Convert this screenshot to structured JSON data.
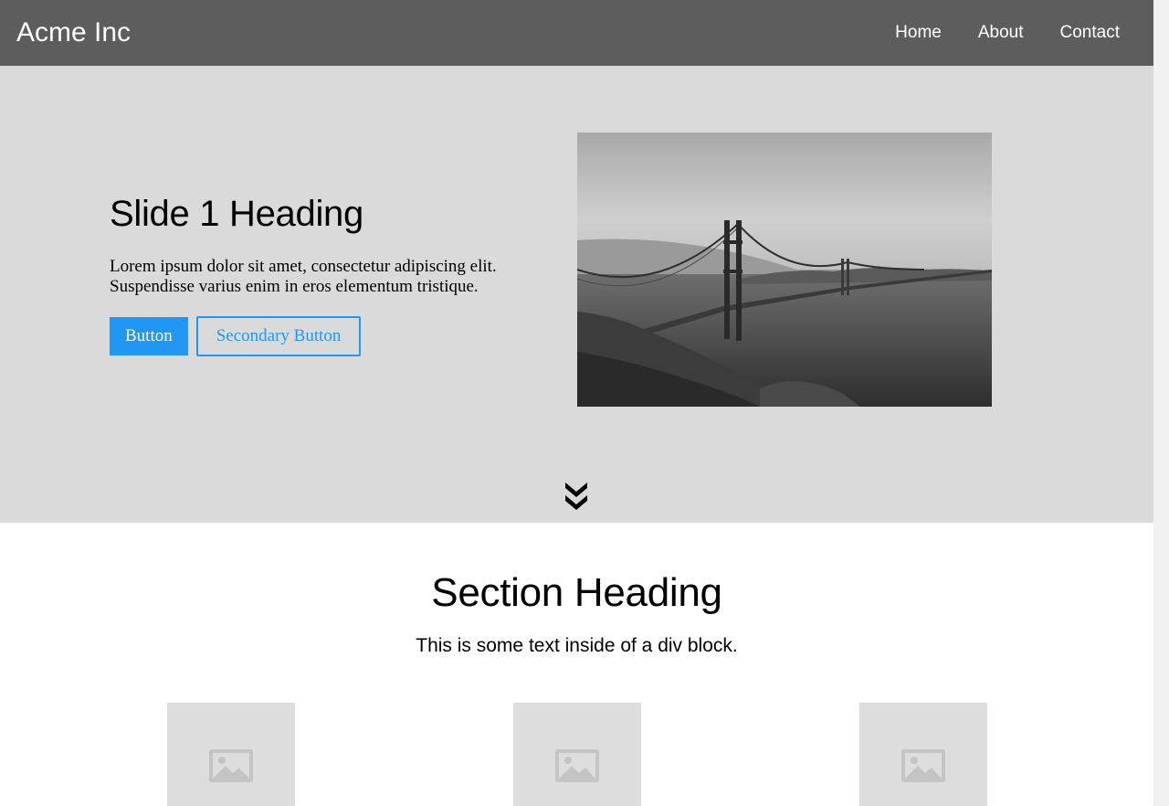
{
  "navbar": {
    "brand": "Acme Inc",
    "links": [
      {
        "label": "Home"
      },
      {
        "label": "About"
      },
      {
        "label": "Contact"
      }
    ]
  },
  "hero": {
    "heading": "Slide 1 Heading",
    "text": "Lorem ipsum dolor sit amet, consectetur adipiscing elit. Suspendisse varius enim in eros elementum tristique.",
    "primary_button": "Button",
    "secondary_button": "Secondary Button",
    "image_icon": "bridge-photo",
    "scroll_icon": "double-chevron-down-icon"
  },
  "section": {
    "heading": "Section Heading",
    "text": "This is some text inside of a div block.",
    "placeholders": [
      {
        "icon": "image-placeholder-icon"
      },
      {
        "icon": "image-placeholder-icon"
      },
      {
        "icon": "image-placeholder-icon"
      }
    ]
  },
  "colors": {
    "navbar_bg": "#5d5d5d",
    "hero_bg": "#dadada",
    "accent": "#2196f3",
    "placeholder_bg": "#dddddd"
  }
}
